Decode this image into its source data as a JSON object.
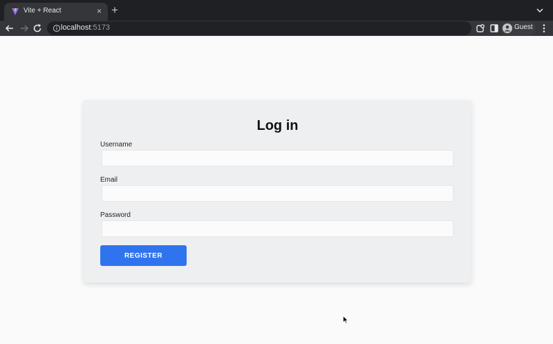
{
  "browser": {
    "tab_title": "Vite + React",
    "tab_close": "×",
    "new_tab": "+",
    "url_host": "localhost",
    "url_port": ":5173",
    "profile_name": "Guest"
  },
  "icons": {
    "favicon": "vite-logo-icon",
    "back": "arrow-left-icon",
    "forward": "arrow-right-icon",
    "reload": "reload-icon",
    "site_info": "info-icon",
    "extensions": "extensions-icon",
    "side_panel": "side-panel-icon",
    "avatar": "person-avatar-icon",
    "menu": "kebab-menu-icon",
    "cursor": "mouse-pointer-icon"
  },
  "form": {
    "title": "Log in",
    "fields": [
      {
        "label": "Username",
        "value": ""
      },
      {
        "label": "Email",
        "value": ""
      },
      {
        "label": "Password",
        "value": ""
      }
    ],
    "submit_label": "REGISTER"
  },
  "colors": {
    "page_background": "#fafafa",
    "card_background": "#eeeff0",
    "primary_button": "#2f74ee",
    "browser_dark": "#1f2023",
    "toolbar": "#35363a"
  }
}
